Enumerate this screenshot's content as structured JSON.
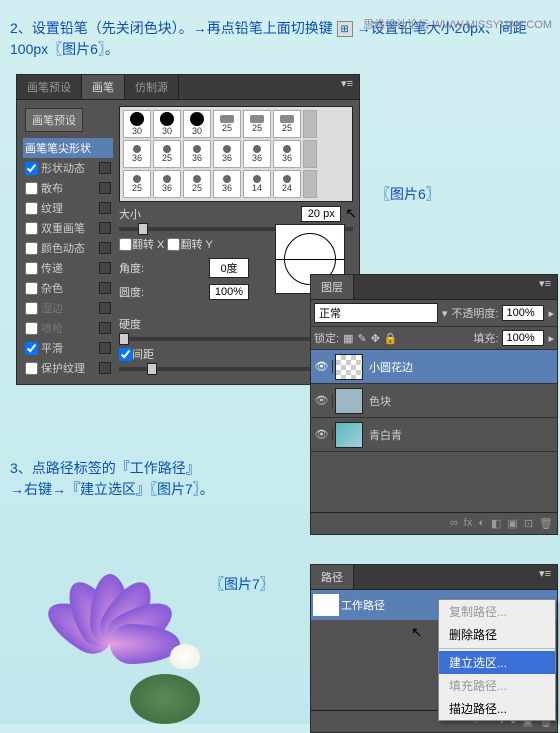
{
  "watermark": "思缘设计论坛  WWW.MISSYUAN.COM",
  "instructions": {
    "step2_a": "2、设置铅笔（先关闭色块）。→再点铅笔上面切换键",
    "step2_b": " →设置铅笔大小20px、间距100px〖图片6〗。",
    "step3_a": "3、点路径标签的『工作路径』",
    "step3_b": "→右键→『建立选区』〖图片7〗。"
  },
  "captions": {
    "img6": "〖图片6〗",
    "img7": "〖图片7〗"
  },
  "brush_panel": {
    "tabs": {
      "t1": "画笔预设",
      "t2": "画笔",
      "t3": "仿制源"
    },
    "preset_btn": "画笔预设",
    "options": [
      {
        "label": "画笔笔尖形状",
        "checked": false,
        "hl": true,
        "nolock": true
      },
      {
        "label": "形状动态",
        "checked": true
      },
      {
        "label": "散布",
        "checked": false
      },
      {
        "label": "纹理",
        "checked": false
      },
      {
        "label": "双重画笔",
        "checked": false
      },
      {
        "label": "颜色动态",
        "checked": false
      },
      {
        "label": "传递",
        "checked": false
      },
      {
        "label": "杂色",
        "checked": false
      },
      {
        "label": "湿边",
        "checked": false,
        "disabled": true
      },
      {
        "label": "喷枪",
        "checked": false,
        "disabled": true
      },
      {
        "label": "平滑",
        "checked": true
      },
      {
        "label": "保护纹理",
        "checked": false
      }
    ],
    "brush_sizes": [
      "30",
      "30",
      "30",
      "25",
      "25",
      "25",
      "36",
      "25",
      "36",
      "36",
      "36",
      "36",
      "25",
      "36",
      "25",
      "36",
      "14",
      "24"
    ],
    "size_label": "大小",
    "size_val": "20 px",
    "flipx": "翻转 X",
    "flipy": "翻转 Y",
    "angle_label": "角度:",
    "angle_val": "0度",
    "round_label": "圆度:",
    "round_val": "100%",
    "hard_label": "硬度",
    "hard_val": "0%",
    "spacing_label": "间距",
    "spacing_val": "100%",
    "spacing_checked": true
  },
  "layers_panel": {
    "title": "图层",
    "blend": "正常",
    "opacity_label": "不透明度:",
    "opacity_val": "100%",
    "lock_label": "锁定:",
    "fill_label": "填充:",
    "fill_val": "100%",
    "layers": [
      {
        "name": "小圆花边",
        "sel": true,
        "thumb": "checker"
      },
      {
        "name": "色块",
        "thumb": "solid"
      },
      {
        "name": "青白青",
        "thumb": "grad"
      }
    ],
    "foot_icons": [
      "∞",
      "fx",
      "◐",
      "◧",
      "▣",
      "⊡",
      "🗑"
    ]
  },
  "paths_panel": {
    "title": "路径",
    "path_name": "工作路径",
    "menu": [
      {
        "label": "复制路径...",
        "dis": true
      },
      {
        "label": "删除路径"
      },
      {
        "sep": true
      },
      {
        "label": "建立选区...",
        "hl": true
      },
      {
        "label": "填充路径...",
        "dis": true
      },
      {
        "label": "描边路径..."
      }
    ],
    "foot_icons": [
      "○",
      "◔",
      "◑",
      "◒",
      "▣",
      "🗑"
    ]
  }
}
